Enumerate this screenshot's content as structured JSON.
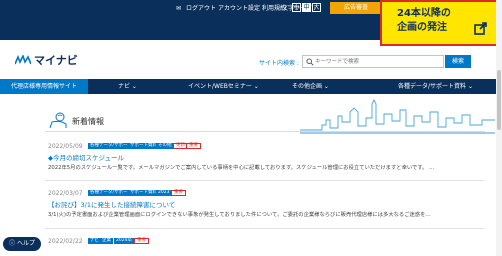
{
  "topbar": {
    "mail": "✉",
    "logout": "ログアウト",
    "account": "アカウント設定",
    "terms": "利用規約",
    "font_size_label": "文字サイズ :",
    "font_small": "小",
    "font_medium": "中",
    "font_large": "大",
    "advertiser_button": "広告審査",
    "font_active": "medium"
  },
  "popup": {
    "line1": "24本以降の",
    "line2": "企画の発注",
    "border_color": "#d92d2d",
    "background": "#ffe500"
  },
  "header": {
    "logo_text": "マイナビ",
    "search_label": "サイト内検索 :",
    "search_placeholder": "キーワードで検索",
    "search_button": "検索"
  },
  "nav": {
    "items": [
      "代理店様専用情報サイト",
      "ナビ",
      "イベント/WEBセミナー",
      "その他企画",
      "各種データ/サポート資料"
    ]
  },
  "news": {
    "title": "新着情報",
    "items": [
      {
        "date": "2022/05/09",
        "tags": [
          "各種データ/サポート資料",
          "サポート資料",
          "その他",
          "更新",
          "重要"
        ],
        "title": "◆今月の締切スケジュール",
        "body": "2022年5月のスケジュール一覧です。メールマガジンでご案内している事柄を中心に記載しております。スケジュール管理にお役立ていただけますと幸いです。 …"
      },
      {
        "date": "2022/03/07",
        "tags": [
          "各種データ/サポート資料",
          "サポート資料",
          "2023",
          "重要"
        ],
        "title": "【お詫び】3/1に発生した接続障害について",
        "body": "3/1(火)の予定書面および企業管理画面にログインできない事象が発生しておりました件について、ご委託の企業様ならびに販売代理店様には多大なるご迷惑を…"
      },
      {
        "date": "2022/02/22",
        "tags": [
          "ナビ",
          "企業",
          "2024卒",
          "重要"
        ],
        "title": "",
        "body": ""
      }
    ]
  },
  "help_button": "ヘルプ",
  "colors": {
    "navy": "#0b2f5b",
    "blue": "#0078c8",
    "orange": "#f0a500",
    "red": "#d92d2d"
  }
}
